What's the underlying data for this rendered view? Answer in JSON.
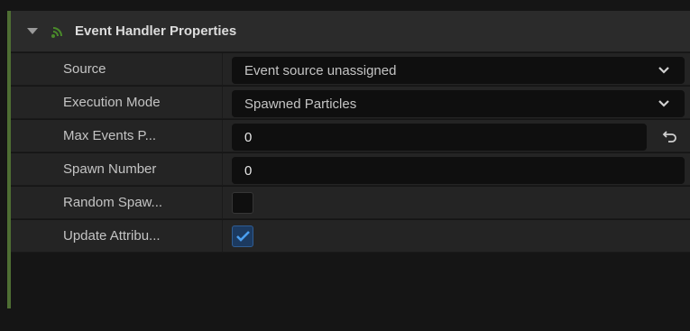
{
  "header": {
    "title": "Event Handler Properties",
    "expand_icon": "triangle-down-icon",
    "section_icon": "event-handler-icon"
  },
  "rows": [
    {
      "label": "Source",
      "type": "dropdown",
      "value": "Event source unassigned"
    },
    {
      "label": "Execution Mode",
      "type": "dropdown",
      "value": "Spawned Particles"
    },
    {
      "label": "Max Events P...",
      "type": "number",
      "value": "0",
      "reset_icon": "reset-arrow-icon"
    },
    {
      "label": "Spawn Number",
      "type": "number",
      "value": "0"
    },
    {
      "label": "Random Spaw...",
      "type": "checkbox",
      "checked": false
    },
    {
      "label": "Update Attribu...",
      "type": "checkbox",
      "checked": true
    }
  ],
  "colors": {
    "accent_bar": "#4e6e33",
    "checkbox_checked": "#2f5d93",
    "checkmark": "#4a9ff0"
  }
}
